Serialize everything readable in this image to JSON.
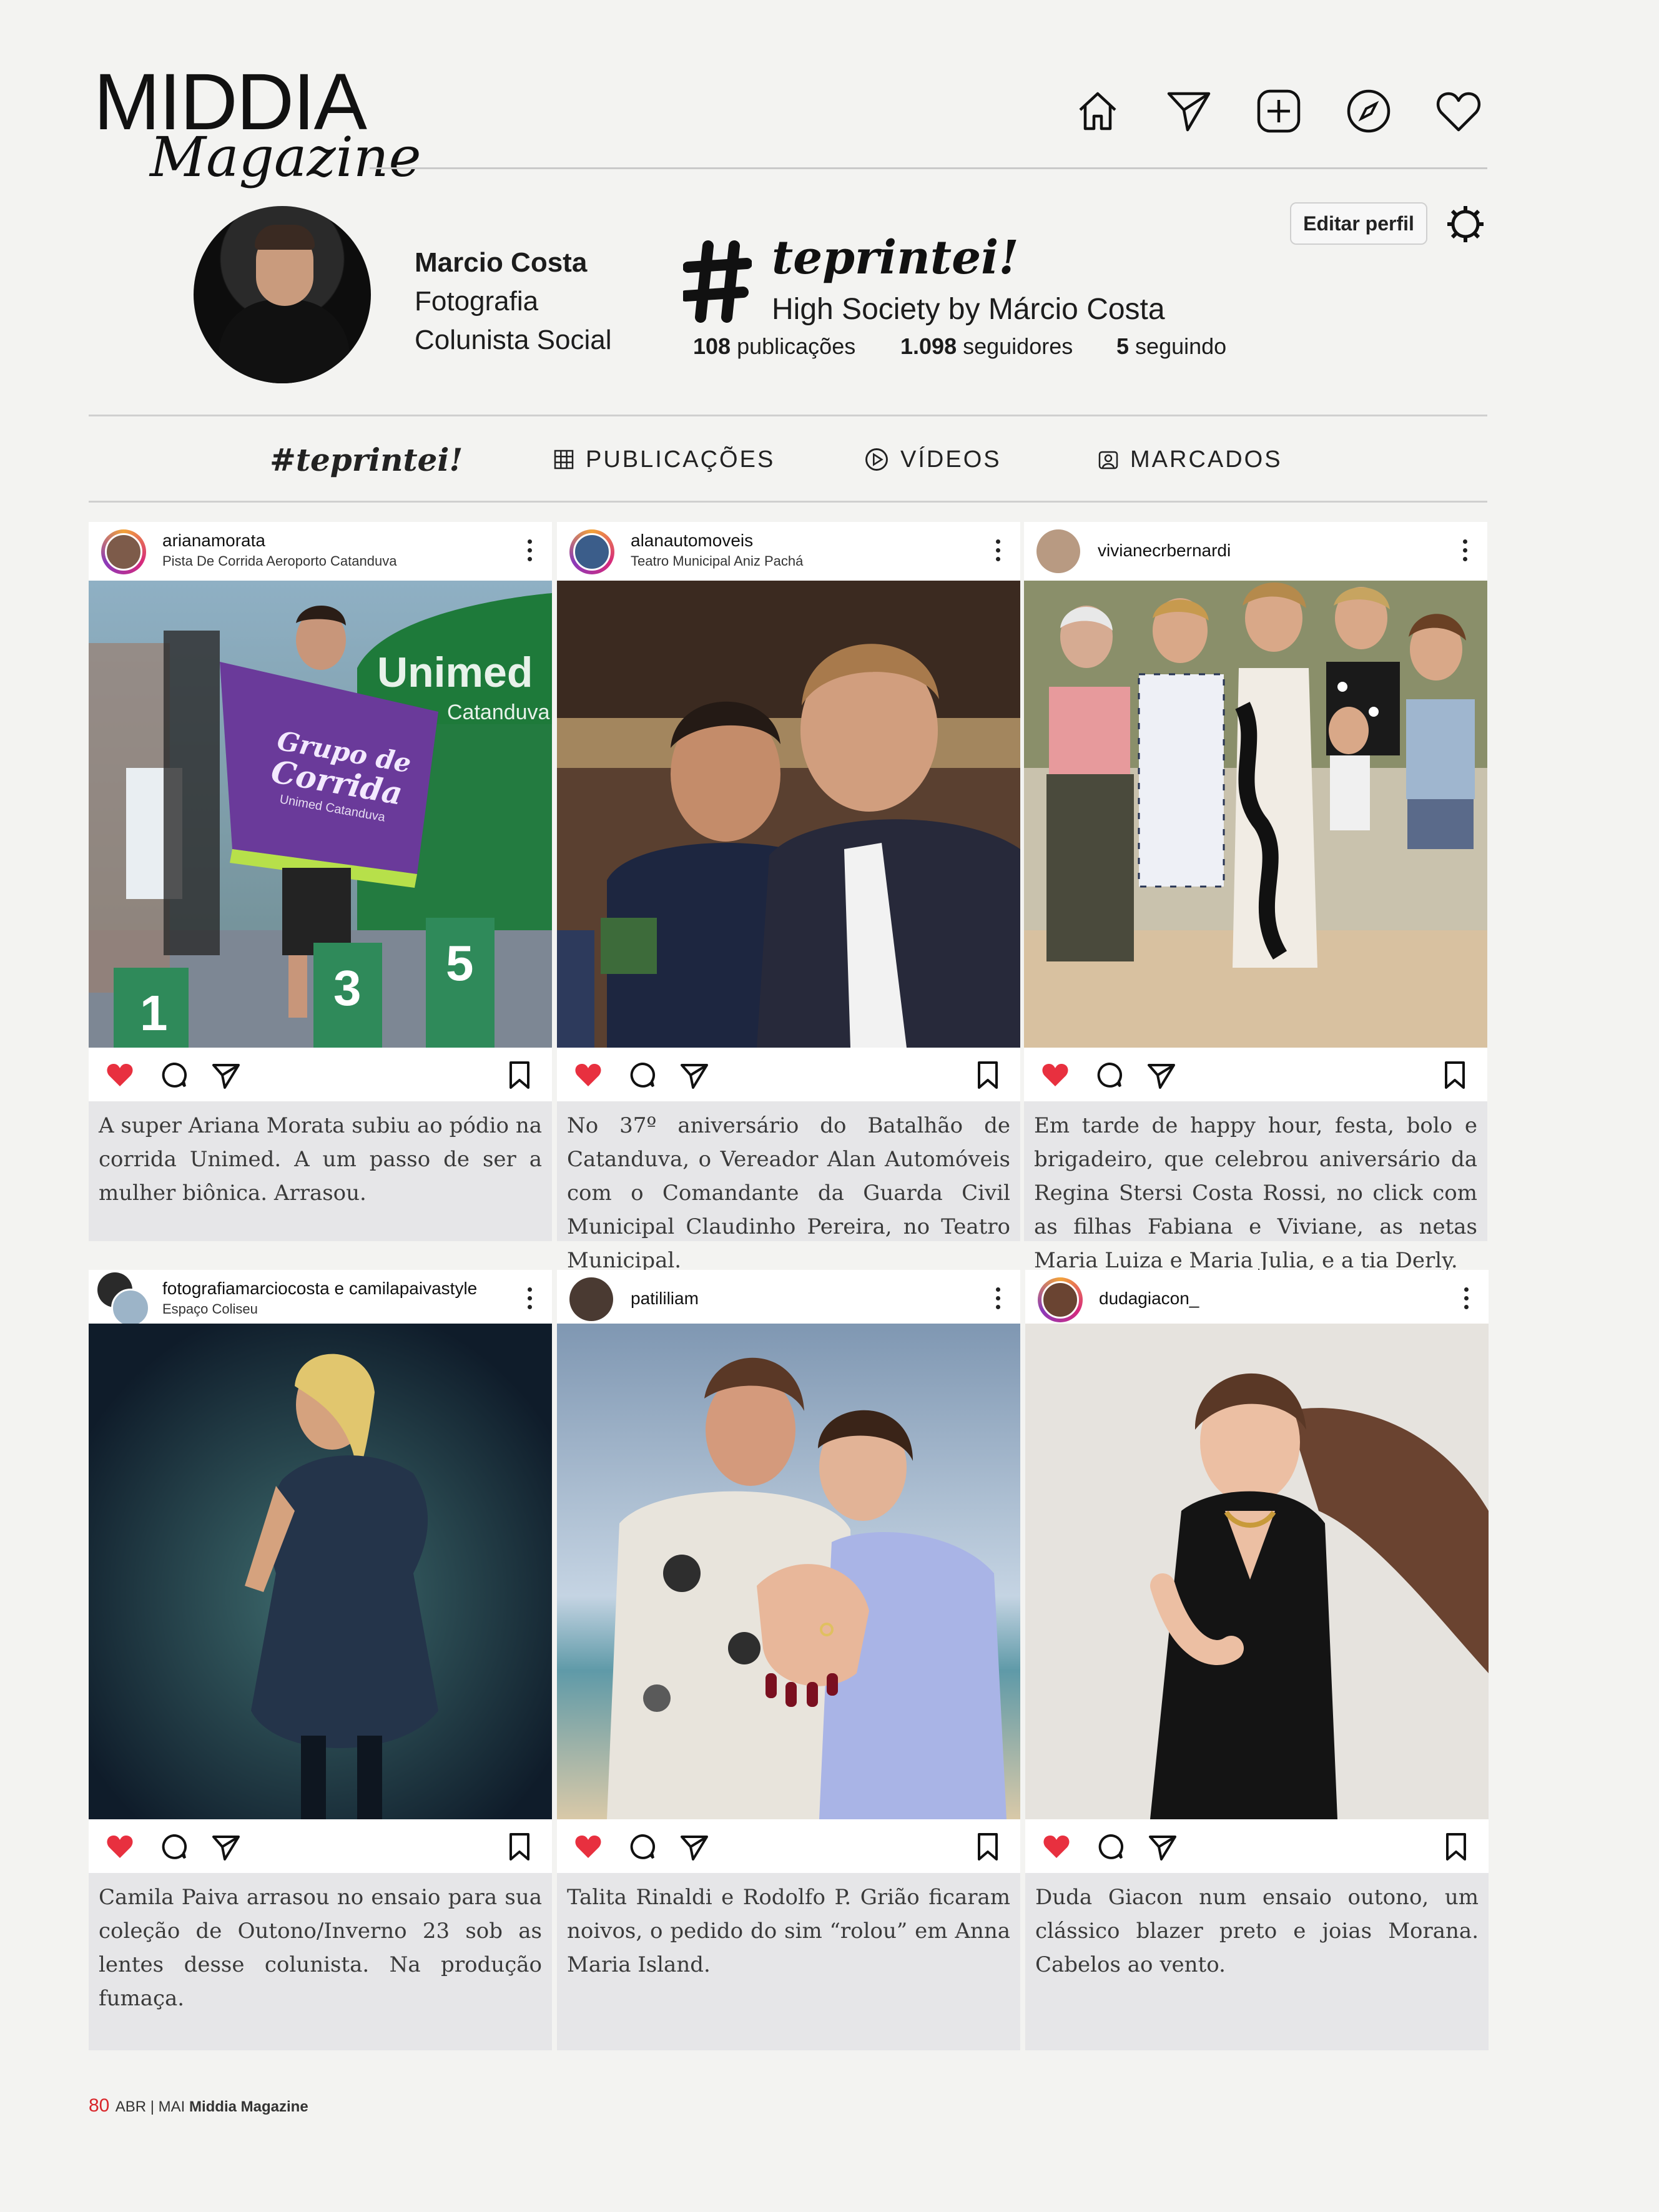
{
  "brand": {
    "name": "MIDDIA",
    "subtitle": "Magazine"
  },
  "nav": [
    "home-icon",
    "send-icon",
    "add-post-icon",
    "explore-icon",
    "heart-icon"
  ],
  "profile": {
    "edit_button": "Editar perfil",
    "name": "Marcio Costa",
    "line2": "Fotografia",
    "line3": "Colunista Social",
    "tag_title": "teprintei!",
    "tag_subtitle": "High Society by Márcio Costa",
    "posts_count": "108",
    "posts_label": "publicações",
    "followers_count": "1.098",
    "followers_label": "seguidores",
    "following_count": "5",
    "following_label": "seguindo"
  },
  "tabs": {
    "tag": "#teprintei!",
    "posts": "PUBLICAÇÕES",
    "videos": "VÍDEOS",
    "tagged": "MARCADOS"
  },
  "posts": [
    {
      "user": "arianamorata",
      "location": "Pista De Corrida Aeroporto Catanduva",
      "caption": "A super Ariana Morata subiu ao pódio na corrida Unimed. A um passo de ser a mulher biônica. Arrasou."
    },
    {
      "user": "alanautomoveis",
      "location": "Teatro Municipal Aniz Pachá",
      "caption": "No 37º aniversário do Batalhão de Catanduva, o Vereador Alan Automóveis com o Comandante da Guarda Civil Municipal Claudinho Pereira, no Teatro Municipal."
    },
    {
      "user": "vivianecrbernardi",
      "location": "",
      "caption": "Em tarde de happy hour, festa, bolo e brigadeiro, que celebrou aniversário da Regina Stersi Costa Rossi, no click com as filhas Fabiana e Viviane, as netas Maria Luiza e Maria Julia, e a tia Derly."
    },
    {
      "user": "fotografiamarciocosta e camilapaivastyle",
      "location": "Espaço Coliseu",
      "caption": "Camila Paiva arrasou no ensaio para sua coleção de Outono/Inverno 23 sob as lentes desse colunista. Na produção fumaça."
    },
    {
      "user": "patililiam",
      "location": "",
      "caption": "Talita Rinaldi e Rodolfo P. Grião ficaram noivos, o pedido do sim “rolou” em Anna Maria Island."
    },
    {
      "user": "dudagiacon_",
      "location": "",
      "caption": "Duda Giacon num ensaio outono, um clássico blazer preto e joias Morana. Cabelos ao vento."
    }
  ],
  "photo_texts": {
    "banner_line1": "Grupo de",
    "banner_line2": "Corrida",
    "banner_line3": "Unimed Catanduva",
    "tent_brand": "Unimed",
    "tent_city": "Catanduva",
    "podium": [
      "1",
      "3",
      "5"
    ]
  },
  "footer": {
    "page": "80",
    "issue": "ABR | MAI",
    "magazine": "Middia Magazine"
  },
  "colors": {
    "like": "#e8303f",
    "background": "#f3f3f1",
    "caption_bg": "#e6e6e8"
  }
}
